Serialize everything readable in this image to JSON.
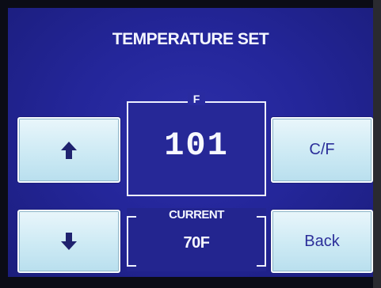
{
  "screen": {
    "title": "TEMPERATURE SET"
  },
  "setpoint": {
    "unit_label": "F",
    "value": "101"
  },
  "current": {
    "label": "CURRENT",
    "value": "70F"
  },
  "buttons": {
    "up_icon": "arrow-up-icon",
    "down_icon": "arrow-down-icon",
    "cf_label": "C/F",
    "back_label": "Back"
  },
  "colors": {
    "background": "#24269a",
    "button_face": "#cdeaf4",
    "button_text": "#2c2f9a",
    "text": "#f4f6ff"
  }
}
